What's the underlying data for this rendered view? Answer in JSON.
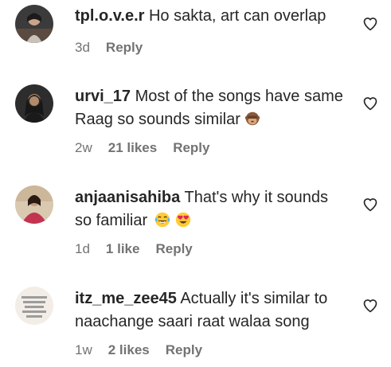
{
  "comments": [
    {
      "username": "tpl.o.v.e.r",
      "text": "Ho sakta, art can overlap",
      "time": "3d",
      "likes": "",
      "reply": "Reply"
    },
    {
      "username": "urvi_17",
      "text": "Most of the songs have same Raag so sounds similar",
      "time": "2w",
      "likes": "21 likes",
      "reply": "Reply",
      "emoji": [
        "see-no-evil-monkey"
      ]
    },
    {
      "username": "anjaanisahiba",
      "text": "That's why it sounds so familiar",
      "time": "1d",
      "likes": "1 like",
      "reply": "Reply",
      "emoji": [
        "tears-of-joy",
        "heart-eyes"
      ]
    },
    {
      "username": "itz_me_zee45",
      "text": "Actually it's similar to naachange saari raat walaa song",
      "time": "1w",
      "likes": "2 likes",
      "reply": "Reply"
    }
  ],
  "colors": {
    "text": "#262626",
    "meta": "#737373",
    "heart_stroke": "#262626",
    "emoji_yellow": "#FFCC33",
    "emoji_red": "#E0245E",
    "monkey_brown": "#8B5A3C"
  },
  "icons": {
    "like": "heart-outline-icon"
  }
}
